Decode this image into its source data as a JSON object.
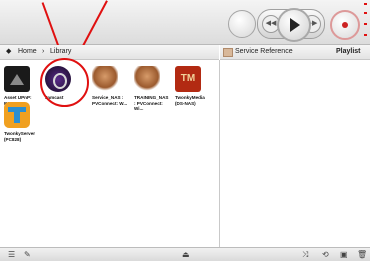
{
  "breadcrumb": {
    "home": "Home",
    "separator": "›",
    "current": "Library"
  },
  "right_header": {
    "title": "Service Reference",
    "playlist": "Playlist"
  },
  "library_items": [
    {
      "label": "Asset UPnP: RSPNAS",
      "icon": "asset-upnp-icon"
    },
    {
      "label": "Jamcast",
      "icon": "jamcast-icon"
    },
    {
      "label": "Service_NAS : PVConnect: W...",
      "icon": "figure-icon"
    },
    {
      "label": "TRAINING_NAS : PVConnect: Wi...",
      "icon": "figure-icon"
    },
    {
      "label": "TwonkyMedia (DS-NAS)",
      "icon": "twonkymedia-icon"
    },
    {
      "label": "TwonkyServer (PC828)",
      "icon": "twonkyserver-icon"
    }
  ],
  "playback": {
    "prev": "◀◀",
    "next": "▶▶",
    "play": "▶",
    "record": "●"
  },
  "colors": {
    "annotation": "#e01010",
    "twonky_red": "#c8201a",
    "twonky_blue": "#2b8fd1",
    "twonky_orange": "#f0a020"
  }
}
